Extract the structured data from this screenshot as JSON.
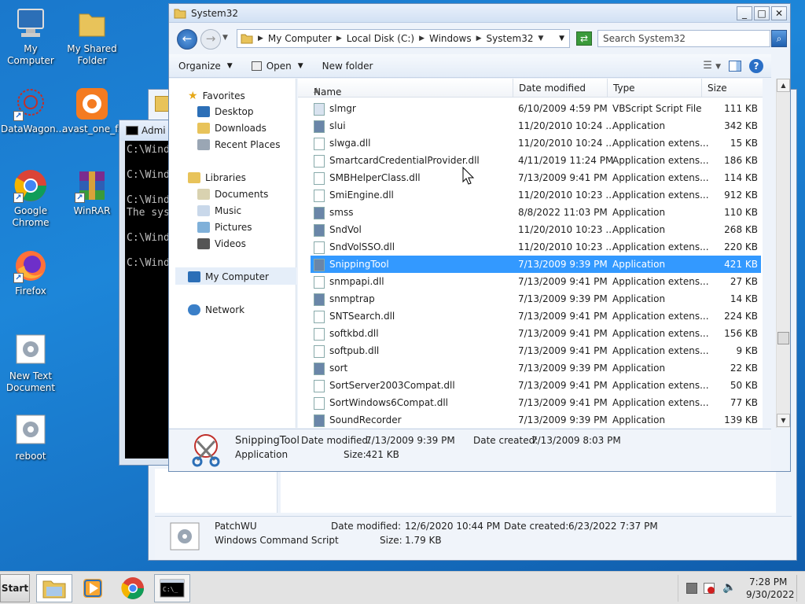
{
  "desktop": {
    "icons": [
      {
        "label": "My Computer"
      },
      {
        "label": "My Shared Folder"
      },
      {
        "label": "DataWagon..."
      },
      {
        "label": "avast_one_f..."
      },
      {
        "label": "Google Chrome"
      },
      {
        "label": "WinRAR"
      },
      {
        "label": "Firefox"
      },
      {
        "label": "New Text Document"
      },
      {
        "label": "reboot"
      }
    ]
  },
  "cmd_window": {
    "title": "Admi",
    "lines": [
      "C:\\Wind",
      "C:\\Wind",
      "C:\\Wind",
      "The sys",
      "C:\\Wind",
      "C:\\Wind"
    ]
  },
  "back_explorer": {
    "details": {
      "name": "PatchWU",
      "type": "Windows Command Script",
      "modified_label": "Date modified:",
      "modified": "12/6/2020 10:44 PM",
      "created_label": "Date created:",
      "created": "6/23/2022 7:37 PM",
      "size_label": "Size:",
      "size": "1.79 KB"
    }
  },
  "explorer": {
    "title": "System32",
    "breadcrumb": [
      "My Computer",
      "Local Disk (C:)",
      "Windows",
      "System32"
    ],
    "search_placeholder": "Search System32",
    "toolbar": {
      "organize": "Organize",
      "open": "Open",
      "new_folder": "New folder"
    },
    "nav": {
      "favorites": "Favorites",
      "desktop": "Desktop",
      "downloads": "Downloads",
      "recent": "Recent Places",
      "libraries": "Libraries",
      "documents": "Documents",
      "music": "Music",
      "pictures": "Pictures",
      "videos": "Videos",
      "computer": "My Computer",
      "network": "Network"
    },
    "columns": {
      "name": "Name",
      "date": "Date modified",
      "type": "Type",
      "size": "Size"
    },
    "files": [
      {
        "name": "slmgr",
        "date": "6/10/2009 4:59 PM",
        "type": "VBScript Script File",
        "size": "111 KB"
      },
      {
        "name": "slui",
        "date": "11/20/2010 10:24 ...",
        "type": "Application",
        "size": "342 KB"
      },
      {
        "name": "slwga.dll",
        "date": "11/20/2010 10:24 ...",
        "type": "Application extens...",
        "size": "15 KB"
      },
      {
        "name": "SmartcardCredentialProvider.dll",
        "date": "4/11/2019 11:24 PM",
        "type": "Application extens...",
        "size": "186 KB"
      },
      {
        "name": "SMBHelperClass.dll",
        "date": "7/13/2009 9:41 PM",
        "type": "Application extens...",
        "size": "114 KB"
      },
      {
        "name": "SmiEngine.dll",
        "date": "11/20/2010 10:23 ...",
        "type": "Application extens...",
        "size": "912 KB"
      },
      {
        "name": "smss",
        "date": "8/8/2022 11:03 PM",
        "type": "Application",
        "size": "110 KB"
      },
      {
        "name": "SndVol",
        "date": "11/20/2010 10:23 ...",
        "type": "Application",
        "size": "268 KB"
      },
      {
        "name": "SndVolSSO.dll",
        "date": "11/20/2010 10:23 ...",
        "type": "Application extens...",
        "size": "220 KB"
      },
      {
        "name": "SnippingTool",
        "date": "7/13/2009 9:39 PM",
        "type": "Application",
        "size": "421 KB"
      },
      {
        "name": "snmpapi.dll",
        "date": "7/13/2009 9:41 PM",
        "type": "Application extens...",
        "size": "27 KB"
      },
      {
        "name": "snmptrap",
        "date": "7/13/2009 9:39 PM",
        "type": "Application",
        "size": "14 KB"
      },
      {
        "name": "SNTSearch.dll",
        "date": "7/13/2009 9:41 PM",
        "type": "Application extens...",
        "size": "224 KB"
      },
      {
        "name": "softkbd.dll",
        "date": "7/13/2009 9:41 PM",
        "type": "Application extens...",
        "size": "156 KB"
      },
      {
        "name": "softpub.dll",
        "date": "7/13/2009 9:41 PM",
        "type": "Application extens...",
        "size": "9 KB"
      },
      {
        "name": "sort",
        "date": "7/13/2009 9:39 PM",
        "type": "Application",
        "size": "22 KB"
      },
      {
        "name": "SortServer2003Compat.dll",
        "date": "7/13/2009 9:41 PM",
        "type": "Application extens...",
        "size": "50 KB"
      },
      {
        "name": "SortWindows6Compat.dll",
        "date": "7/13/2009 9:41 PM",
        "type": "Application extens...",
        "size": "77 KB"
      },
      {
        "name": "SoundRecorder",
        "date": "7/13/2009 9:39 PM",
        "type": "Application",
        "size": "139 KB"
      }
    ],
    "selected_index": 9,
    "details": {
      "name": "SnippingTool",
      "type": "Application",
      "modified_label": "Date modified:",
      "modified": "7/13/2009 9:39 PM",
      "created_label": "Date created:",
      "created": "7/13/2009 8:03 PM",
      "size_label": "Size:",
      "size": "421 KB"
    }
  },
  "taskbar": {
    "start": "Start",
    "time": "7:28 PM",
    "date": "9/30/2022"
  },
  "colors": {
    "selection": "#3399ff",
    "desktop": "#1a78cc"
  }
}
